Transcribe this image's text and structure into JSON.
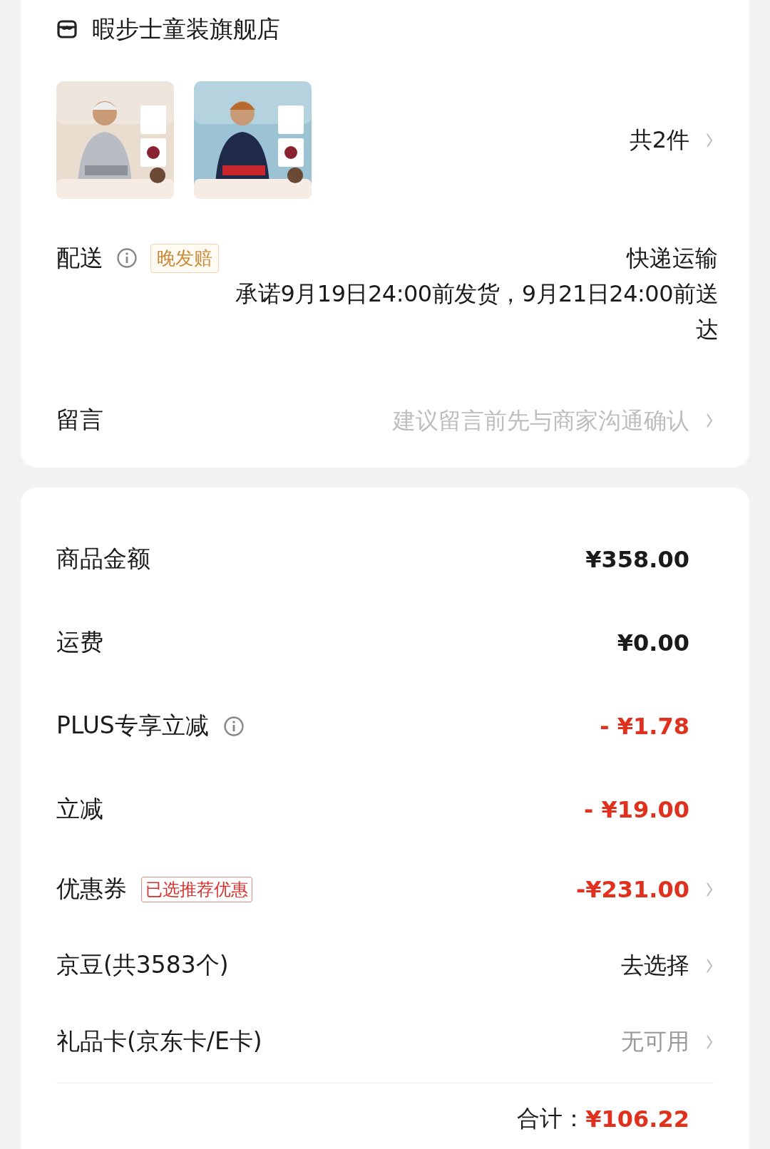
{
  "store": {
    "name": "暇步士童装旗舰店"
  },
  "products": {
    "count": "共2件"
  },
  "delivery": {
    "label": "配送",
    "info": true,
    "tag": "晚发赔",
    "method": "快递运输",
    "promise": "承诺9月19日24:00前发货，9月21日24:00前送达"
  },
  "message": {
    "label": "留言",
    "placeholder": "建议留言前先与商家沟通确认"
  },
  "summary": [
    {
      "label": "商品金额",
      "info": false,
      "value": "¥358.00",
      "kind": "price",
      "chevron": false
    },
    {
      "label": "运费",
      "info": false,
      "value": "¥0.00",
      "kind": "price",
      "chevron": false
    },
    {
      "label": "PLUS专享立减",
      "info": true,
      "value": "- ¥1.78",
      "kind": "discount",
      "chevron": false
    },
    {
      "label": "立减",
      "info": false,
      "value": "- ¥19.00",
      "kind": "discount",
      "chevron": false
    },
    {
      "label": "优惠券",
      "info": false,
      "tag": "已选推荐优惠",
      "value": "-¥231.00",
      "kind": "discount",
      "chevron": true
    },
    {
      "label": "京豆(共3583个)",
      "info": false,
      "value": "去选择",
      "kind": "plain",
      "chevron": true
    },
    {
      "label": "礼品卡(京东卡/E卡)",
      "info": false,
      "value": "无可用",
      "kind": "muted",
      "chevron": true
    }
  ],
  "total": {
    "label": "合计：",
    "value": "¥106.22"
  }
}
